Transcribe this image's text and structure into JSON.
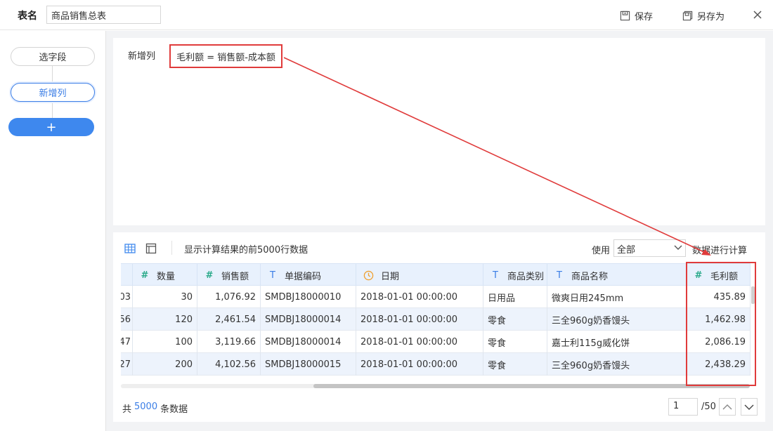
{
  "header": {
    "title_label": "表名",
    "title_value": "商品销售总表",
    "save_label": "保存",
    "save_as_label": "另存为"
  },
  "steps": {
    "select_fields": "选字段",
    "new_column": "新增列",
    "add": "+"
  },
  "formula_panel": {
    "label": "新增列",
    "formula": "毛利额 = 销售额-成本额"
  },
  "toolbar": {
    "hint": "显示计算结果的前5000行数据",
    "use_label": "使用",
    "use_value": "全部",
    "calc_label": "数据进行计算"
  },
  "table": {
    "columns": [
      {
        "label": "数量",
        "type": "#"
      },
      {
        "label": "销售额",
        "type": "#"
      },
      {
        "label": "单据编码",
        "type": "T"
      },
      {
        "label": "日期",
        "type": "clock"
      },
      {
        "label": "商品类别",
        "type": "T"
      },
      {
        "label": "商品名称",
        "type": "T"
      },
      {
        "label": "毛利额",
        "type": "#"
      }
    ],
    "rows": [
      {
        "partial": "03",
        "qty": "30",
        "sales": "1,076.92",
        "code": "SMDBJ18000010",
        "date": "2018-01-01 00:00:00",
        "category": "日用品",
        "name": "微爽日用245mm",
        "profit": "435.89"
      },
      {
        "partial": "56",
        "qty": "120",
        "sales": "2,461.54",
        "code": "SMDBJ18000014",
        "date": "2018-01-01 00:00:00",
        "category": "零食",
        "name": "三全960g奶香馒头",
        "profit": "1,462.98"
      },
      {
        "partial": "47",
        "qty": "100",
        "sales": "3,119.66",
        "code": "SMDBJ18000014",
        "date": "2018-01-01 00:00:00",
        "category": "零食",
        "name": "嘉士利115g威化饼",
        "profit": "2,086.19"
      },
      {
        "partial": "27",
        "qty": "200",
        "sales": "4,102.56",
        "code": "SMDBJ18000015",
        "date": "2018-01-01 00:00:00",
        "category": "零食",
        "name": "三全960g奶香馒头",
        "profit": "2,438.29"
      }
    ]
  },
  "footer": {
    "total_prefix": "共",
    "total_count": "5000",
    "total_suffix": "条数据",
    "page_current": "1",
    "page_total": "/50"
  },
  "colors": {
    "accent": "#3e88ee",
    "highlight": "#e03b3b",
    "header_bg": "#e8f1fd"
  }
}
